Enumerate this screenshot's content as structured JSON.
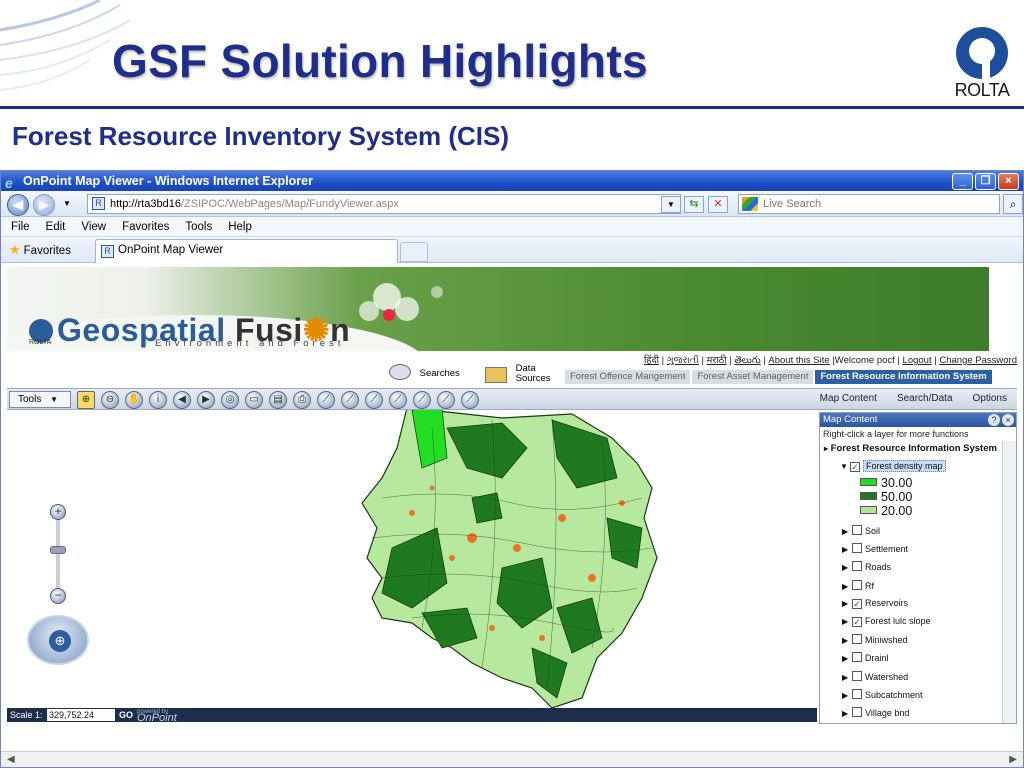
{
  "slide": {
    "title": "GSF Solution Highlights",
    "subtitle": "Forest Resource Inventory System (CIS)",
    "logo_text": "ROLTA",
    "title_color": "#1f2e8a"
  },
  "browser": {
    "window_title": "OnPoint Map Viewer - Windows Internet Explorer",
    "address_host": "http://rta3bd16",
    "address_path": "/ZSIPOC/WebPages/Map/FundyViewer.aspx",
    "search_placeholder": "Live Search",
    "menu": [
      "File",
      "Edit",
      "View",
      "Favorites",
      "Tools",
      "Help"
    ],
    "favorites_label": "Favorites",
    "tab_label": "OnPoint Map Viewer"
  },
  "app": {
    "brand_geo": "Geospatial",
    "brand_fusion": "Fusi",
    "brand_on": "n",
    "brand_sub": "Environment and Forest",
    "brand_rolta": "ROLTA",
    "header_links": [
      "हिंदी",
      "ગુજરાતી",
      "मराठी",
      "తెలుగు"
    ],
    "about_link": "About this Site",
    "welcome": "Welcome pocf",
    "logout": "Logout",
    "change_password": "Change Password",
    "searches": "Searches",
    "data_sources_1": "Data",
    "data_sources_2": "Sources",
    "tabs": [
      "Forest Offence Mangement",
      "Forest Asset Management",
      "Forest Resource Information System"
    ],
    "active_tab": "Forest Resource Information System",
    "tools_label": "Tools",
    "right_tabs": [
      "Map Content",
      "Search/Data",
      "Options"
    ]
  },
  "map_content": {
    "header": "Map Content",
    "hint": "Right-click a layer for more functions",
    "root": "Forest Resource Information System",
    "density_layer": "Forest density map",
    "legend": [
      {
        "label": "30.00",
        "color": "#22dd22"
      },
      {
        "label": "50.00",
        "color": "#1f7a1f"
      },
      {
        "label": "20.00",
        "color": "#b6e39a"
      }
    ],
    "layers": [
      {
        "label": "Soil",
        "checked": false
      },
      {
        "label": "Settlement",
        "checked": false
      },
      {
        "label": "Roads",
        "checked": false
      },
      {
        "label": "Rf",
        "checked": false
      },
      {
        "label": "Reservoirs",
        "checked": true
      },
      {
        "label": "Forest lulc slope",
        "checked": true
      },
      {
        "label": "Miniwshed",
        "checked": false
      },
      {
        "label": "Drainl",
        "checked": false
      },
      {
        "label": "Watershed",
        "checked": false
      },
      {
        "label": "Subcatchment",
        "checked": false
      },
      {
        "label": "Village bnd",
        "checked": false
      }
    ]
  },
  "scale": {
    "label": "Scale 1:",
    "value": "329,752.24",
    "go": "GO",
    "powered": "powered by",
    "onpoint": "OnPoint"
  }
}
